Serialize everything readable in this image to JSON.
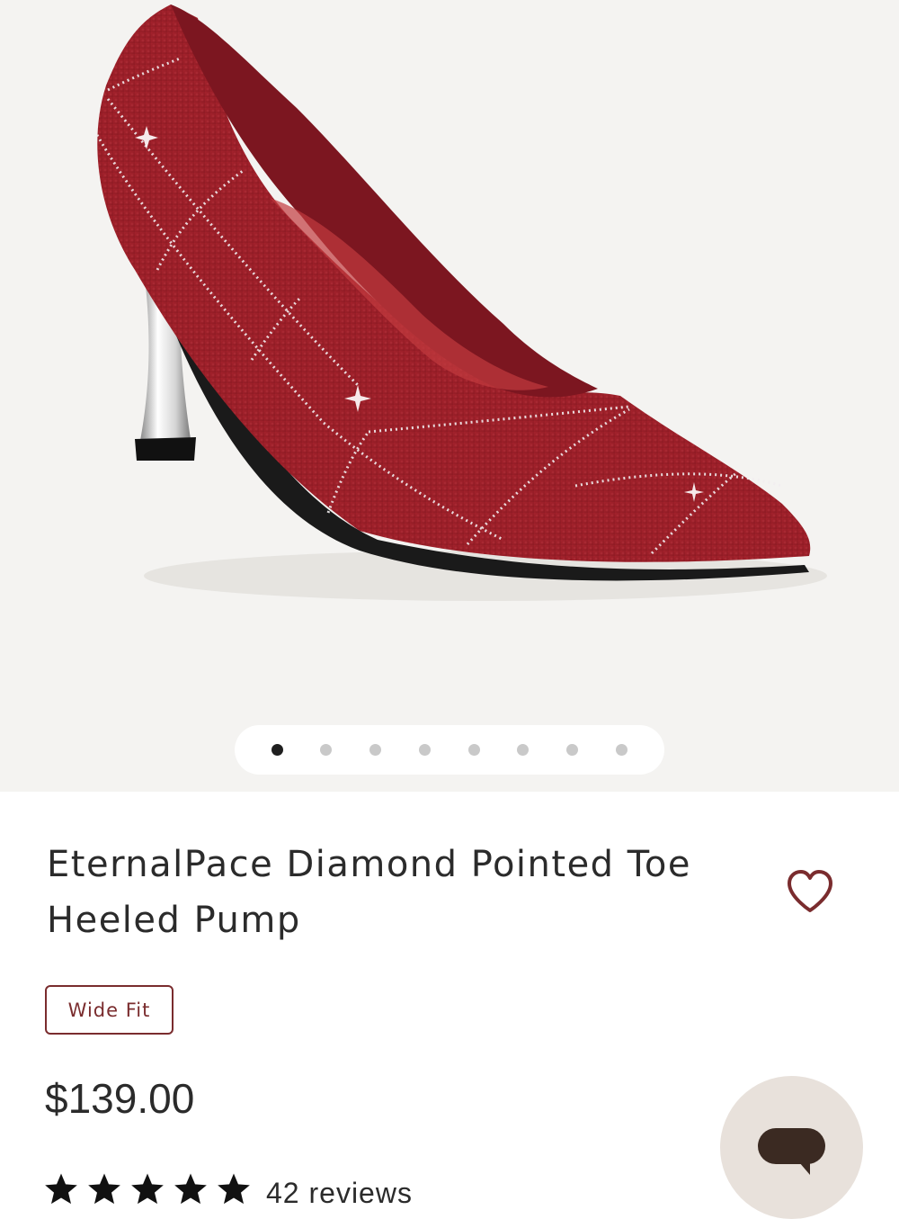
{
  "gallery": {
    "image_alt": "Red knit pointed toe heeled pump with rhinestone plaid pattern and silver heel",
    "total_slides": 8,
    "active_slide": 1
  },
  "product": {
    "title": "EternalPace Diamond Pointed Toe Heeled Pump",
    "badge": "Wide Fit",
    "price": "$139.00",
    "rating": 5,
    "reviews": "42 reviews"
  },
  "icons": {
    "wishlist": "heart-outline-icon",
    "chat": "chat-bubble-icon",
    "star": "star-filled-icon"
  },
  "colors": {
    "accent": "#7a2c2e",
    "image_background": "#f4f3f1",
    "chat_button": "#e8e1db",
    "chat_icon": "#3b2a22"
  }
}
